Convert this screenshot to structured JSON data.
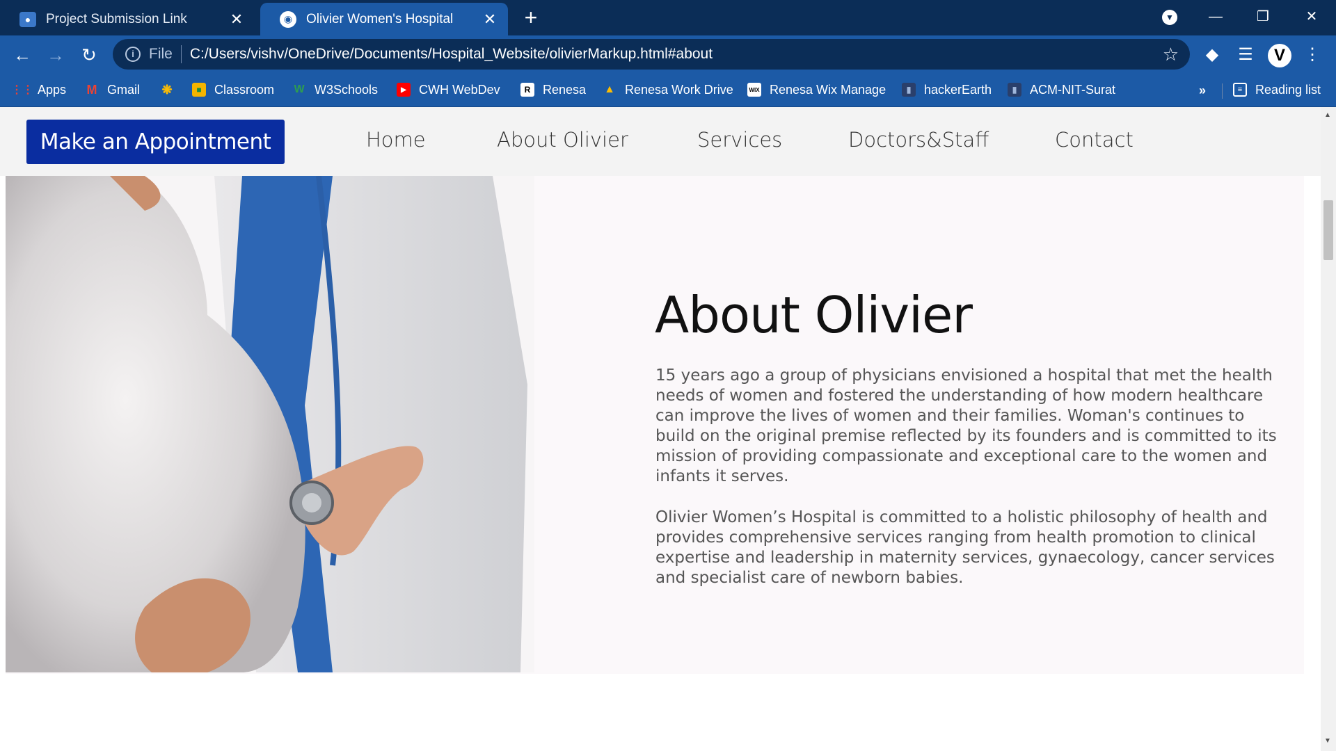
{
  "browser": {
    "tabs": [
      {
        "title": "Project Submission Link",
        "active": false
      },
      {
        "title": "Olivier Women's Hospital",
        "active": true
      }
    ],
    "omnibox": {
      "scheme": "File",
      "url": "C:/Users/vishv/OneDrive/Documents/Hospital_Website/olivierMarkup.html#about"
    },
    "avatar_letter": "V",
    "bookmarks": [
      {
        "label": "Apps"
      },
      {
        "label": "Gmail"
      },
      {
        "label": ""
      },
      {
        "label": "Classroom"
      },
      {
        "label": "W3Schools"
      },
      {
        "label": "CWH WebDev"
      },
      {
        "label": "Renesa"
      },
      {
        "label": "Renesa Work Drive"
      },
      {
        "label": "Renesa Wix Manage"
      },
      {
        "label": "hackerEarth"
      },
      {
        "label": "ACM-NIT-Surat"
      }
    ],
    "bookmarks_more": "»",
    "reading_list": "Reading list"
  },
  "site": {
    "appointment_button": "Make an Appointment",
    "nav": [
      "Home",
      "About Olivier",
      "Services",
      "Doctors&Staff",
      "Contact"
    ],
    "about": {
      "title": "About Olivier",
      "paragraph1": "15 years ago a group of physicians envisioned a hospital that met the health needs of women and fostered the understanding of how modern healthcare can improve the lives of women and their families. Woman's continues to build on the original premise reflected by its founders and is committed to its mission of providing compassionate and exceptional care to the women and infants it serves.",
      "paragraph2": "Olivier Women’s Hospital is committed to a holistic philosophy of health and provides comprehensive services ranging from health promotion to clinical expertise and leadership in maternity services, gynaecology, cancer services and specialist care of newborn babies."
    }
  },
  "colors": {
    "titlebar": "#0b2d57",
    "toolbar": "#1c5aa6",
    "appointment_button": "#0a2da0",
    "section_bg": "#fbf8fa"
  }
}
